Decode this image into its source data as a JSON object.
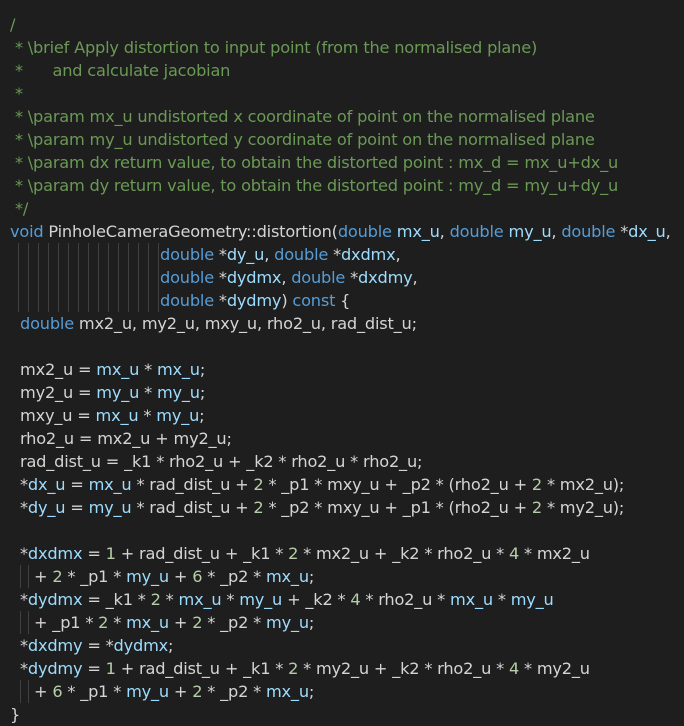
{
  "editor": {
    "language": "cpp",
    "background": "#1e1e1e",
    "colors": {
      "comment": "#6a9955",
      "keyword": "#569cd6",
      "identifier": "#d4d4d4",
      "parameter": "#9cdcfe",
      "number": "#b5cea8",
      "indent_guide": "#404040"
    },
    "lines": [
      [
        "/"
      ],
      [
        " * \\brief Apply distortion to input point (from the normalised plane)"
      ],
      [
        " *      and calculate jacobian"
      ],
      [
        " *"
      ],
      [
        " * \\param mx_u undistorted x coordinate of point on the normalised plane"
      ],
      [
        " * \\param my_u undistorted y coordinate of point on the normalised plane"
      ],
      [
        " * \\param dx return value, to obtain the distorted point : mx_d = mx_u+dx_u"
      ],
      [
        " * \\param dy return value, to obtain the distorted point : my_d = my_u+dy_u"
      ],
      [
        " */"
      ],
      [
        "void",
        " PinholeCameraGeometry::distortion(",
        "double",
        " ",
        "mx_u",
        ", ",
        "double",
        " ",
        "my_u",
        ", ",
        "double",
        " *",
        "dx_u",
        ","
      ],
      [
        "double",
        " *",
        "dy_u",
        ", ",
        "double",
        " *",
        "dxdmx",
        ","
      ],
      [
        "double",
        " *",
        "dydmx",
        ", ",
        "double",
        " *",
        "dxdmy",
        ","
      ],
      [
        "double",
        " *",
        "dydmy",
        ") ",
        "const",
        " {"
      ],
      [
        "double",
        " mx2_u, my2_u, mxy_u, rho2_u, rad_dist_u;"
      ],
      [
        ""
      ],
      [
        "mx2_u = ",
        "mx_u",
        " * ",
        "mx_u",
        ";"
      ],
      [
        "my2_u = ",
        "my_u",
        " * ",
        "my_u",
        ";"
      ],
      [
        "mxy_u = ",
        "mx_u",
        " * ",
        "my_u",
        ";"
      ],
      [
        "rho2_u = mx2_u + my2_u;"
      ],
      [
        "rad_dist_u = _k1 * rho2_u + _k2 * rho2_u * rho2_u;"
      ],
      [
        "*",
        "dx_u",
        " = ",
        "mx_u",
        " * rad_dist_u + ",
        "2",
        " * _p1 * mxy_u + _p2 * (rho2_u + ",
        "2",
        " * mx2_u);"
      ],
      [
        "*",
        "dy_u",
        " = ",
        "my_u",
        " * rad_dist_u + ",
        "2",
        " * _p2 * mxy_u + _p1 * (rho2_u + ",
        "2",
        " * my2_u);"
      ],
      [
        ""
      ],
      [
        "*",
        "dxdmx",
        " = ",
        "1",
        " + rad_dist_u + _k1 * ",
        "2",
        " * mx2_u + _k2 * rho2_u * ",
        "4",
        " * mx2_u"
      ],
      [
        "+ ",
        "2",
        " * _p1 * ",
        "my_u",
        " + ",
        "6",
        " * _p2 * ",
        "mx_u",
        ";"
      ],
      [
        "*",
        "dydmx",
        " = _k1 * ",
        "2",
        " * ",
        "mx_u",
        " * ",
        "my_u",
        " + _k2 * ",
        "4",
        " * rho2_u * ",
        "mx_u",
        " * ",
        "my_u"
      ],
      [
        "+ _p1 * ",
        "2",
        " * ",
        "mx_u",
        " + ",
        "2",
        " * _p2 * ",
        "my_u",
        ";"
      ],
      [
        "*",
        "dxdmy",
        " = *",
        "dydmx",
        ";"
      ],
      [
        "*",
        "dydmy",
        " = ",
        "1",
        " + rad_dist_u + _k1 * ",
        "2",
        " * my2_u + _k2 * rho2_u * ",
        "4",
        " * my2_u"
      ],
      [
        "+ ",
        "6",
        " * _p1 * ",
        "my_u",
        " + ",
        "2",
        " * _p2 * ",
        "mx_u",
        ";"
      ],
      [
        "}"
      ]
    ]
  }
}
